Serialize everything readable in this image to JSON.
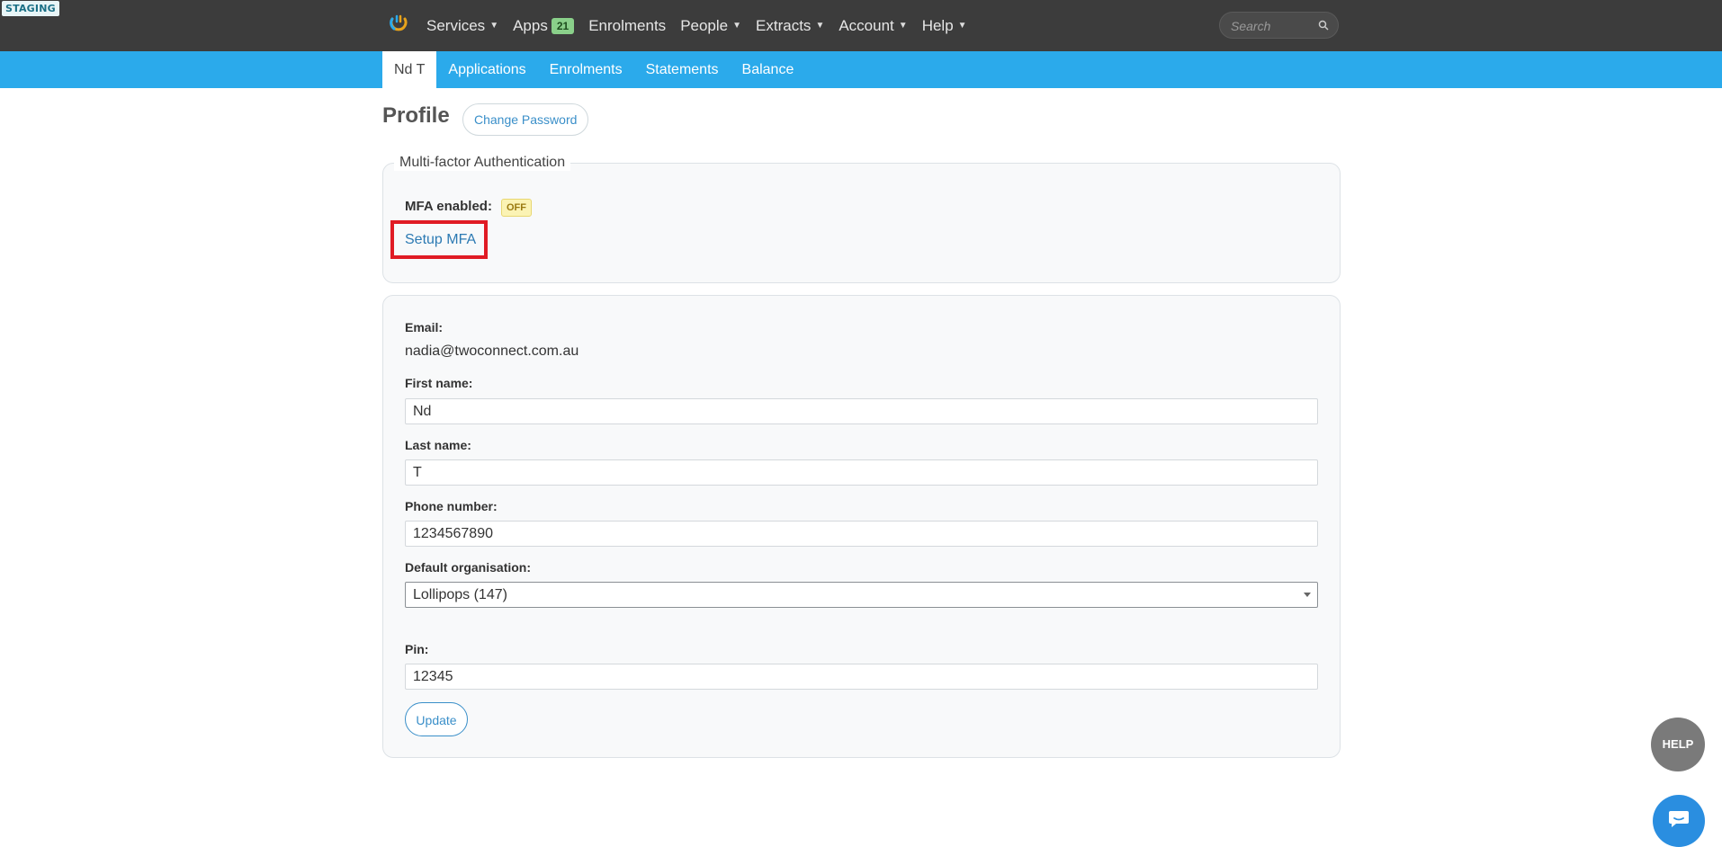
{
  "env_badge": "STAGING",
  "topnav": {
    "items": [
      {
        "label": "Services",
        "dropdown": true
      },
      {
        "label": "Apps",
        "badge": "21"
      },
      {
        "label": "Enrolments"
      },
      {
        "label": "People",
        "dropdown": true
      },
      {
        "label": "Extracts",
        "dropdown": true
      },
      {
        "label": "Account",
        "dropdown": true
      },
      {
        "label": "Help",
        "dropdown": true
      }
    ],
    "search_placeholder": "Search"
  },
  "subnav": {
    "items": [
      {
        "label": "Nd T",
        "active": true
      },
      {
        "label": "Applications"
      },
      {
        "label": "Enrolments"
      },
      {
        "label": "Statements"
      },
      {
        "label": "Balance"
      }
    ]
  },
  "profile": {
    "title": "Profile",
    "change_password_label": "Change Password"
  },
  "mfa": {
    "legend": "Multi-factor Authentication",
    "enabled_label": "MFA enabled:",
    "status": "OFF",
    "setup_label": "Setup MFA"
  },
  "form": {
    "email_label": "Email:",
    "email_value": "nadia@twoconnect.com.au",
    "first_name_label": "First name:",
    "first_name_value": "Nd",
    "last_name_label": "Last name:",
    "last_name_value": "T",
    "phone_label": "Phone number:",
    "phone_value": "1234567890",
    "org_label": "Default organisation:",
    "org_value": "Lollipops (147)",
    "pin_label": "Pin:",
    "pin_value": "12345",
    "update_label": "Update"
  },
  "help_button": "HELP",
  "colors": {
    "topbar": "#3c3c3c",
    "subbar": "#2baaeb",
    "link": "#2c7ab3",
    "highlight": "#e01b24"
  }
}
